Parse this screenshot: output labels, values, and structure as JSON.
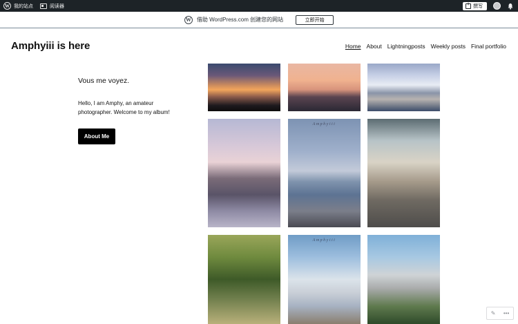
{
  "admin_bar": {
    "my_site": "我的站点",
    "reader": "阅读器",
    "write": "撰写"
  },
  "banner": {
    "text": "借助 WordPress.com 创建您的网站",
    "button": "立即开始"
  },
  "site": {
    "title": "Amphyiii is here"
  },
  "nav": {
    "items": [
      "Home",
      "About",
      "Lightningposts",
      "Weekly posts",
      "Final portfolio"
    ]
  },
  "intro": {
    "heading": "Vous me voyez.",
    "text": "Hello, I am Amphy, an amateur photographer. Welcome to my album!",
    "button": "About Me"
  },
  "gallery": {
    "caption": "Amphyiii"
  },
  "icons": {
    "wp": "wordpress-logo-icon",
    "reader": "reader-icon",
    "write": "write-icon",
    "avatar": "avatar-icon",
    "notifications": "bell-icon",
    "edit": "pencil-icon",
    "more": "ellipsis-icon"
  },
  "colors": {
    "admin_bar_bg": "#1d2327",
    "button_bg": "#000000"
  }
}
